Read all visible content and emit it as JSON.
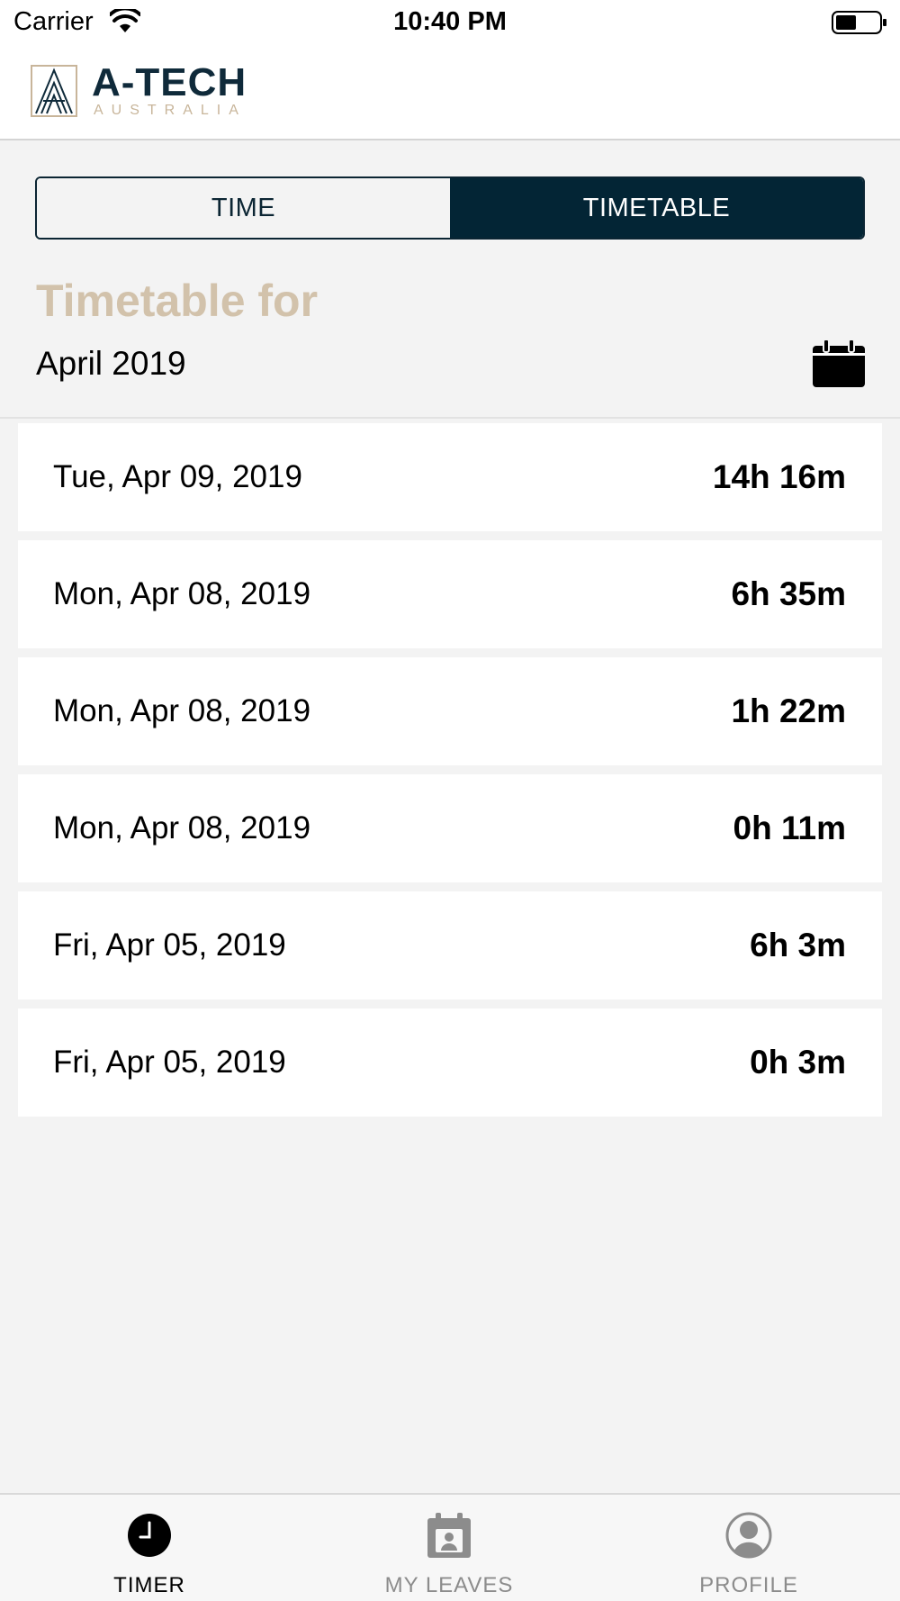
{
  "status_bar": {
    "carrier": "Carrier",
    "time": "10:40 PM"
  },
  "header": {
    "logo_main": "A-TECH",
    "logo_sub": "AUSTRALIA"
  },
  "segmented": {
    "time_label": "TIME",
    "timetable_label": "TIMETABLE",
    "selected": "TIMETABLE"
  },
  "title": {
    "heading": "Timetable for",
    "month": "April 2019"
  },
  "entries": [
    {
      "date": "Tue, Apr 09, 2019",
      "duration": "14h 16m"
    },
    {
      "date": "Mon, Apr 08, 2019",
      "duration": "6h 35m"
    },
    {
      "date": "Mon, Apr 08, 2019",
      "duration": "1h 22m"
    },
    {
      "date": "Mon, Apr 08, 2019",
      "duration": "0h 11m"
    },
    {
      "date": "Fri, Apr 05, 2019",
      "duration": "6h 3m"
    },
    {
      "date": "Fri, Apr 05, 2019",
      "duration": "0h 3m"
    }
  ],
  "tabbar": {
    "timer_label": "TIMER",
    "leaves_label": "MY LEAVES",
    "profile_label": "PROFILE",
    "selected": "TIMER"
  },
  "colors": {
    "accent_dark": "#032535",
    "heading_tan": "#d2c2ab",
    "background": "#f3f3f3"
  },
  "icons": {
    "wifi": "wifi-icon",
    "battery": "battery-icon",
    "logo": "a-tech-logo-icon",
    "calendar": "calendar-icon",
    "timer": "clock-icon",
    "leaves": "calendar-badge-icon",
    "profile": "user-circle-icon"
  }
}
